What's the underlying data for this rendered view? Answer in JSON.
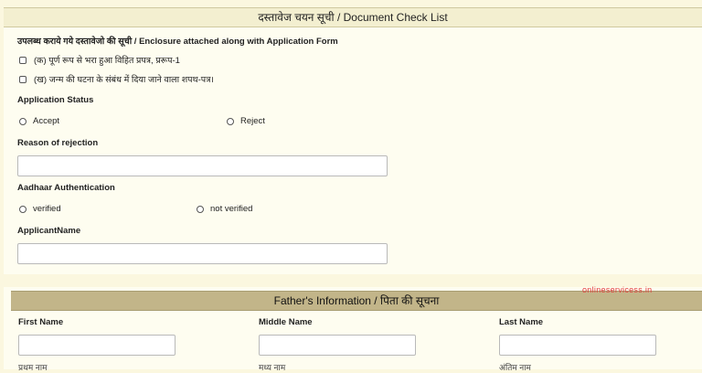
{
  "checklist": {
    "header": "दस्तावेज चयन सूची / Document Check List",
    "enclosure_label": "उपलब्ध कराये गये दस्तावेजो की सूची / Enclosure attached along with Application Form",
    "items": [
      {
        "label": "(क) पूर्ण रूप से भरा हुआ विहित प्रपत्र, प्ररूप-1",
        "checked": false
      },
      {
        "label": "(ख) जन्म की घटना के संबंध में दिया जाने वाला शपथ-पत्र।",
        "checked": false
      }
    ]
  },
  "application_status": {
    "label": "Application Status",
    "options": [
      "Accept",
      "Reject"
    ]
  },
  "rejection": {
    "label": "Reason of rejection",
    "value": ""
  },
  "aadhaar": {
    "label": "Aadhaar Authentication",
    "options": [
      "verified",
      "not verified"
    ]
  },
  "applicant": {
    "label": "ApplicantName",
    "value": ""
  },
  "father": {
    "header": "Father's Information / पिता की सूचना",
    "first_name_label": "First Name",
    "middle_name_label": "Middle Name",
    "last_name_label": "Last Name",
    "first_name_value": "",
    "middle_name_value": "",
    "last_name_value": ""
  },
  "watermark": "onlineservicess.in",
  "clipped_labels": [
    "प्रथम नाम",
    "मध्य नाम",
    "अंतिम नाम"
  ]
}
